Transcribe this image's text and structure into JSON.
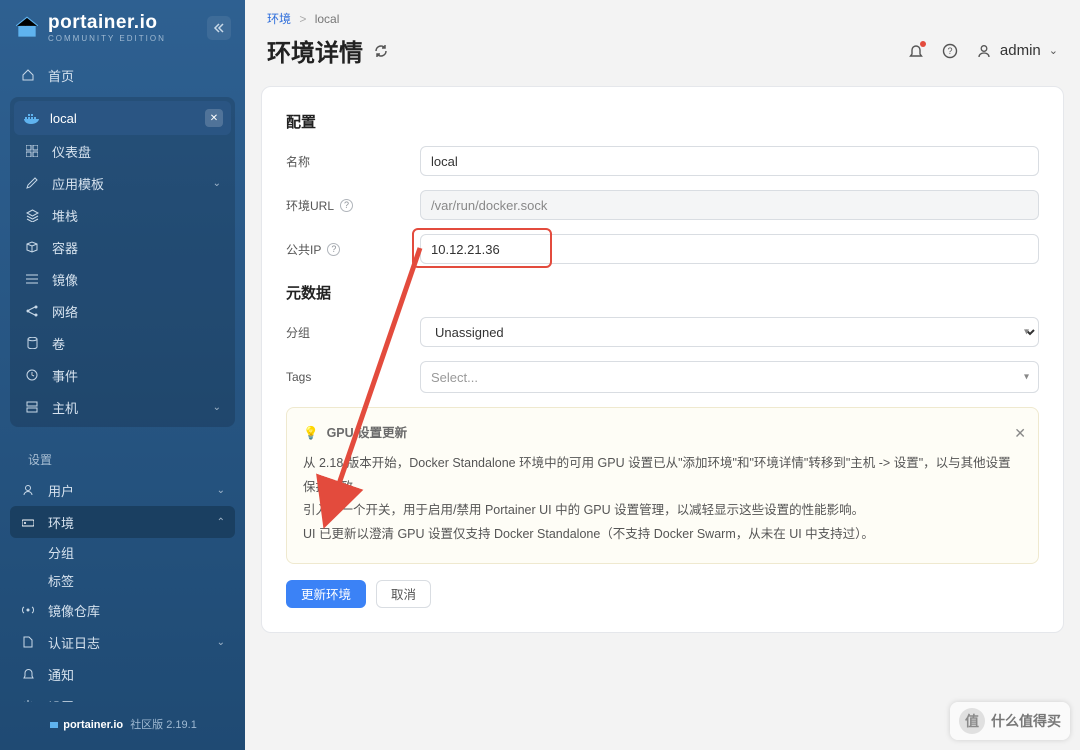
{
  "brand": {
    "name": "portainer.io",
    "edition": "COMMUNITY EDITION",
    "footer_prefix": "portainer.io",
    "footer_label": "社区版",
    "version": "2.19.1"
  },
  "user": {
    "name": "admin"
  },
  "breadcrumb": {
    "root": "环境",
    "current": "local"
  },
  "page": {
    "title": "环境详情"
  },
  "env_pill": {
    "name": "local"
  },
  "sidebar": {
    "home": "首页",
    "env_items": [
      "仪表盘",
      "应用模板",
      "堆栈",
      "容器",
      "镜像",
      "网络",
      "卷",
      "事件",
      "主机"
    ],
    "settings_label": "设置",
    "settings_items": [
      "用户",
      "环境"
    ],
    "env_sub": [
      "分组",
      "标签"
    ],
    "settings_items2": [
      "镜像仓库",
      "认证日志",
      "通知",
      "设置"
    ]
  },
  "form": {
    "section_config": "配置",
    "name_label": "名称",
    "name_value": "local",
    "url_label": "环境URL",
    "url_value": "/var/run/docker.sock",
    "ip_label": "公共IP",
    "ip_value": "10.12.21.36",
    "section_meta": "元数据",
    "group_label": "分组",
    "group_value": "Unassigned",
    "tags_label": "Tags",
    "tags_placeholder": "Select..."
  },
  "info": {
    "title": "GPU 设置更新",
    "line1": "从 2.18 版本开始，Docker Standalone 环境中的可用 GPU 设置已从\"添加环境\"和\"环境详情\"转移到\"主机 -> 设置\"，以与其他设置保持一致。",
    "line2": "引入了一个开关，用于启用/禁用 Portainer UI 中的 GPU 设置管理，以减轻显示这些设置的性能影响。",
    "line3": "UI 已更新以澄清 GPU 设置仅支持 Docker Standalone（不支持 Docker Swarm，从未在 UI 中支持过）。"
  },
  "buttons": {
    "save": "更新环境",
    "cancel": "取消"
  },
  "watermark": "什么值得买"
}
